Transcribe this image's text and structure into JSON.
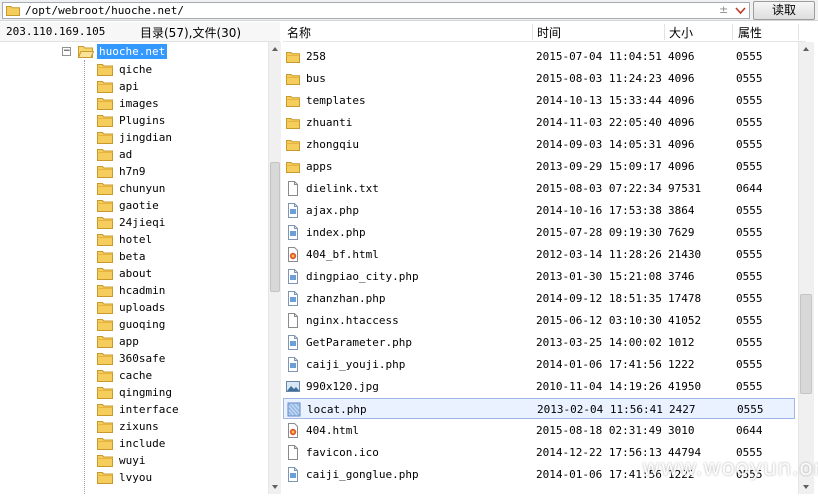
{
  "pathbar": {
    "path": "/opt/webroot/huoche.net/",
    "dropdown_plus": "±",
    "read_button": "读取"
  },
  "tree_header": {
    "ip": "203.110.169.105",
    "count": "目录(57),文件(30)"
  },
  "tree": {
    "root_label": "huoche.net",
    "collapse_glyph": "−",
    "items": [
      {
        "label": "qiche"
      },
      {
        "label": "api"
      },
      {
        "label": "images"
      },
      {
        "label": "Plugins"
      },
      {
        "label": "jingdian"
      },
      {
        "label": "ad"
      },
      {
        "label": "h7n9"
      },
      {
        "label": "chunyun"
      },
      {
        "label": "gaotie"
      },
      {
        "label": "24jieqi"
      },
      {
        "label": "hotel"
      },
      {
        "label": "beta"
      },
      {
        "label": "about"
      },
      {
        "label": "hcadmin"
      },
      {
        "label": "uploads"
      },
      {
        "label": "guoqing"
      },
      {
        "label": "app"
      },
      {
        "label": "360safe"
      },
      {
        "label": "cache"
      },
      {
        "label": "qingming"
      },
      {
        "label": "interface"
      },
      {
        "label": "zixuns"
      },
      {
        "label": "include"
      },
      {
        "label": "wuyi"
      },
      {
        "label": "lvyou"
      }
    ]
  },
  "list_header": {
    "name": "名称",
    "time": "时间",
    "size": "大小",
    "perm": "属性"
  },
  "files": [
    {
      "name": "258",
      "time": "2015-07-04 11:04:51",
      "size": "4096",
      "perm": "0555",
      "icon": "folder"
    },
    {
      "name": "bus",
      "time": "2015-08-03 11:24:23",
      "size": "4096",
      "perm": "0555",
      "icon": "folder"
    },
    {
      "name": "templates",
      "time": "2014-10-13 15:33:44",
      "size": "4096",
      "perm": "0555",
      "icon": "folder"
    },
    {
      "name": "zhuanti",
      "time": "2014-11-03 22:05:40",
      "size": "4096",
      "perm": "0555",
      "icon": "folder"
    },
    {
      "name": "zhongqiu",
      "time": "2014-09-03 14:05:31",
      "size": "4096",
      "perm": "0555",
      "icon": "folder"
    },
    {
      "name": "apps",
      "time": "2013-09-29 15:09:17",
      "size": "4096",
      "perm": "0555",
      "icon": "folder"
    },
    {
      "name": "dielink.txt",
      "time": "2015-08-03 07:22:34",
      "size": "97531",
      "perm": "0644",
      "icon": "text"
    },
    {
      "name": "ajax.php",
      "time": "2014-10-16 17:53:38",
      "size": "3864",
      "perm": "0555",
      "icon": "script"
    },
    {
      "name": "index.php",
      "time": "2015-07-28 09:19:30",
      "size": "7629",
      "perm": "0555",
      "icon": "script"
    },
    {
      "name": "404_bf.html",
      "time": "2012-03-14 11:28:26",
      "size": "21430",
      "perm": "0555",
      "icon": "html"
    },
    {
      "name": "dingpiao_city.php",
      "time": "2013-01-30 15:21:08",
      "size": "3746",
      "perm": "0555",
      "icon": "script"
    },
    {
      "name": "zhanzhan.php",
      "time": "2014-09-12 18:51:35",
      "size": "17478",
      "perm": "0555",
      "icon": "script"
    },
    {
      "name": "nginx.htaccess",
      "time": "2015-06-12 03:10:30",
      "size": "41052",
      "perm": "0555",
      "icon": "text"
    },
    {
      "name": "GetParameter.php",
      "time": "2013-03-25 14:00:02",
      "size": "1012",
      "perm": "0555",
      "icon": "script"
    },
    {
      "name": "caiji_youji.php",
      "time": "2014-01-06 17:41:56",
      "size": "1222",
      "perm": "0555",
      "icon": "script"
    },
    {
      "name": "990x120.jpg",
      "time": "2010-11-04 14:19:26",
      "size": "41950",
      "perm": "0555",
      "icon": "image"
    },
    {
      "name": "locat.php",
      "time": "2013-02-04 11:56:41",
      "size": "2427",
      "perm": "0555",
      "icon": "script-selected",
      "selected": true
    },
    {
      "name": "404.html",
      "time": "2015-08-18 02:31:49",
      "size": "3010",
      "perm": "0644",
      "icon": "html"
    },
    {
      "name": "favicon.ico",
      "time": "2014-12-22 17:56:13",
      "size": "44794",
      "perm": "0555",
      "icon": "text"
    },
    {
      "name": "caiji_gonglue.php",
      "time": "2014-01-06 17:41:56",
      "size": "1222",
      "perm": "0555",
      "icon": "script"
    }
  ],
  "watermark": "www.wooyun.org"
}
